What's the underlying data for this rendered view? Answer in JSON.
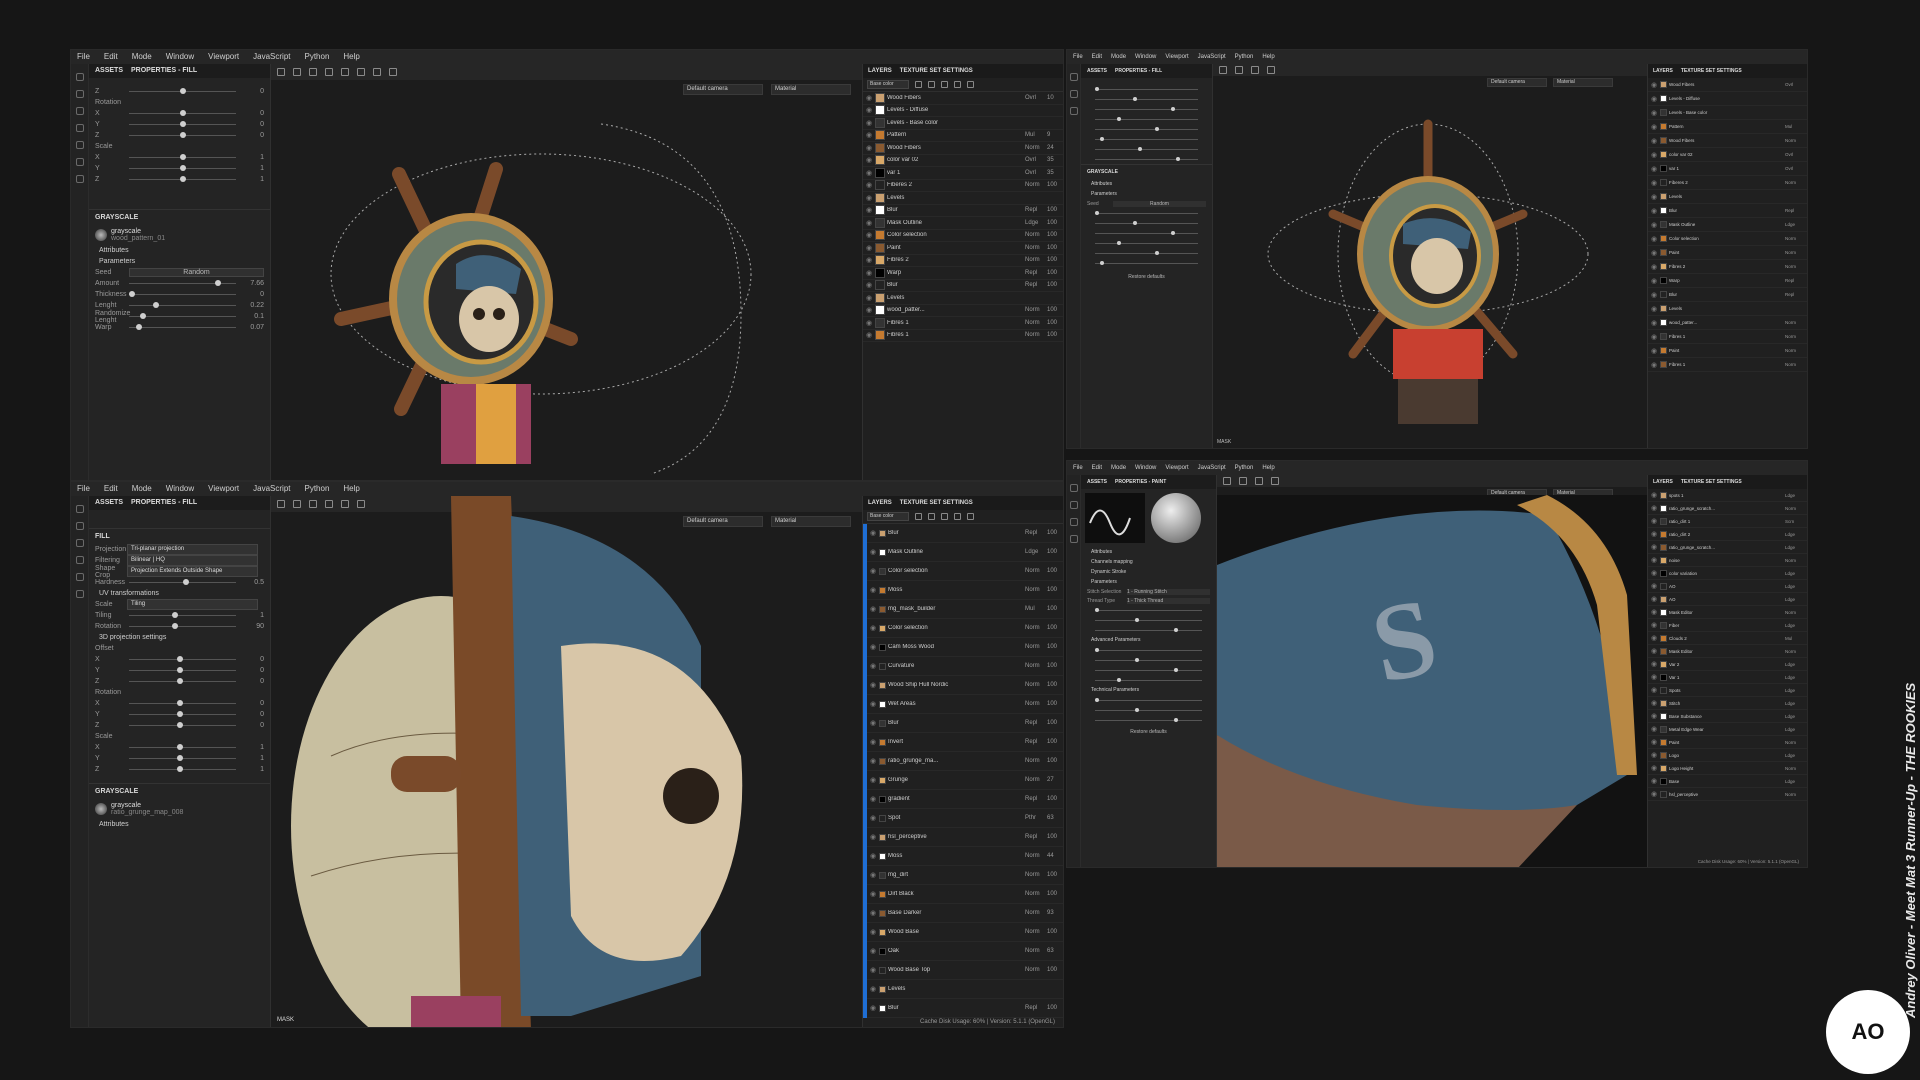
{
  "menu": [
    "File",
    "Edit",
    "Mode",
    "Window",
    "Viewport",
    "JavaScript",
    "Python",
    "Help"
  ],
  "tl": {
    "props_tabs": [
      "ASSETS",
      "PROPERTIES - FILL"
    ],
    "rows_top": [
      {
        "l": "Z",
        "v": "0"
      },
      {
        "l": "Rotation",
        "v": ""
      },
      {
        "l": "X",
        "v": "0"
      },
      {
        "l": "Y",
        "v": "0"
      },
      {
        "l": "Z",
        "v": "0"
      },
      {
        "l": "Scale",
        "v": ""
      },
      {
        "l": "X",
        "v": "1"
      },
      {
        "l": "Y",
        "v": "1"
      },
      {
        "l": "Z",
        "v": "1"
      }
    ],
    "grayscale_label": "GRAYSCALE",
    "gs_name": "grayscale",
    "gs_file": "wood_pattern_01",
    "attributes": "Attributes",
    "parameters": "Parameters",
    "seed_label": "Seed",
    "seed_value": "Random",
    "params": [
      {
        "l": "Amount",
        "v": "7.66"
      },
      {
        "l": "Thickness",
        "v": "0"
      },
      {
        "l": "Lenght",
        "v": "0.22"
      },
      {
        "l": "Randomize Lenght",
        "v": "0.1"
      },
      {
        "l": "Warp",
        "v": "0.07"
      }
    ],
    "camera": "Default camera",
    "material": "Material",
    "layers_tabs": [
      "LAYERS",
      "TEXTURE SET SETTINGS"
    ],
    "base_color": "Base color",
    "layers": [
      {
        "n": "Wood Fibers",
        "b": "Ovrl",
        "o": "10"
      },
      {
        "n": "Levels - Diffuse",
        "b": "",
        "o": ""
      },
      {
        "n": "Levels - Base color",
        "b": "",
        "o": ""
      },
      {
        "n": "Pattern",
        "b": "Mul",
        "o": "9"
      },
      {
        "n": "Wood Fibers",
        "b": "Norm",
        "o": "24"
      },
      {
        "n": "color var 02",
        "b": "Ovrl",
        "o": "35"
      },
      {
        "n": "var 1",
        "b": "Ovrl",
        "o": "35"
      },
      {
        "n": "Fiberes 2",
        "b": "Norm",
        "o": "100"
      },
      {
        "n": "Levels",
        "b": "",
        "o": ""
      },
      {
        "n": "Blur",
        "b": "Repl",
        "o": "100"
      },
      {
        "n": "Mask Outline",
        "b": "Ldge",
        "o": "100"
      },
      {
        "n": "Color selection",
        "b": "Norm",
        "o": "100"
      },
      {
        "n": "Paint",
        "b": "Norm",
        "o": "100"
      },
      {
        "n": "Fibres 2",
        "b": "Norm",
        "o": "100"
      },
      {
        "n": "Warp",
        "b": "Repl",
        "o": "100"
      },
      {
        "n": "Blur",
        "b": "Repl",
        "o": "100"
      },
      {
        "n": "Levels",
        "b": "",
        "o": ""
      },
      {
        "n": "wood_patter...",
        "b": "Norm",
        "o": "100"
      },
      {
        "n": "Fibres 1",
        "b": "Norm",
        "o": "100"
      },
      {
        "n": "Fibres 1",
        "b": "Norm",
        "o": "100"
      }
    ]
  },
  "bl": {
    "fill": "FILL",
    "projection_label": "Projection",
    "projection_value": "Tri-planar projection",
    "filtering_label": "Filtering",
    "filtering_value": "Bilinear | HQ",
    "shapecrop_label": "Shape Crop",
    "shapecrop_value": "Projection Extends Outside Shape",
    "hardness_label": "Hardness",
    "hardness_value": "0.5",
    "uv": "UV transformations",
    "scale_label": "Scale",
    "scale_value": "Tiling",
    "tiling_label": "Tiling",
    "tiling_value": "1",
    "rotation_label": "Rotation",
    "rotation_value": "90",
    "proj3d": "3D projection settings",
    "rows": [
      {
        "l": "Offset",
        "v": ""
      },
      {
        "l": "X",
        "v": "0"
      },
      {
        "l": "Y",
        "v": "0"
      },
      {
        "l": "Z",
        "v": "0"
      },
      {
        "l": "Rotation",
        "v": ""
      },
      {
        "l": "X",
        "v": "0"
      },
      {
        "l": "Y",
        "v": "0"
      },
      {
        "l": "Z",
        "v": "0"
      },
      {
        "l": "Scale",
        "v": ""
      },
      {
        "l": "X",
        "v": "1"
      },
      {
        "l": "Y",
        "v": "1"
      },
      {
        "l": "Z",
        "v": "1"
      }
    ],
    "gs_file": "ratio_grunge_map_008",
    "mask": "MASK",
    "layers": [
      {
        "n": "Blur",
        "b": "Repl",
        "o": "100"
      },
      {
        "n": "Mask Outline",
        "b": "Ldge",
        "o": "100"
      },
      {
        "n": "Color selection",
        "b": "Norm",
        "o": "100"
      },
      {
        "n": "Moss",
        "b": "Norm",
        "o": "100"
      },
      {
        "n": "mg_mask_builder",
        "b": "Mul",
        "o": "100"
      },
      {
        "n": "Color selection",
        "b": "Norm",
        "o": "100"
      },
      {
        "n": "Cam Moss Wood",
        "b": "Norm",
        "o": "100"
      },
      {
        "n": "Curvature",
        "b": "Norm",
        "o": "100"
      },
      {
        "n": "Wood Ship Hull Nordic",
        "b": "Norm",
        "o": "100"
      },
      {
        "n": "Wet Areas",
        "b": "Norm",
        "o": "100"
      },
      {
        "n": "Blur",
        "b": "Repl",
        "o": "100"
      },
      {
        "n": "Invert",
        "b": "Repl",
        "o": "100"
      },
      {
        "n": "ratio_grunge_ma...",
        "b": "Norm",
        "o": "100"
      },
      {
        "n": "Grunge",
        "b": "Norm",
        "o": "27"
      },
      {
        "n": "gradient",
        "b": "Repl",
        "o": "100"
      },
      {
        "n": "Spot",
        "b": "Pthr",
        "o": "63"
      },
      {
        "n": "hsl_perceptive",
        "b": "Repl",
        "o": "100"
      },
      {
        "n": "Moss",
        "b": "Norm",
        "o": "44"
      },
      {
        "n": "mg_dirt",
        "b": "Norm",
        "o": "100"
      },
      {
        "n": "Dirt Black",
        "b": "Norm",
        "o": "100"
      },
      {
        "n": "Base Darker",
        "b": "Norm",
        "o": "93"
      },
      {
        "n": "Wood Base",
        "b": "Norm",
        "o": "100"
      },
      {
        "n": "Oak",
        "b": "Norm",
        "o": "63"
      },
      {
        "n": "Wood Base Top",
        "b": "Norm",
        "o": "100"
      },
      {
        "n": "Levels",
        "b": "",
        "o": ""
      },
      {
        "n": "Blur",
        "b": "Repl",
        "o": "100"
      }
    ],
    "status": "Cache Disk Usage: 60% | Version: 5.1.1 (OpenGL)"
  },
  "tr": {
    "grayscale": "GRAYSCALE",
    "attributes": "Attributes",
    "parameters": "Parameters",
    "seed": "Seed",
    "seed_value": "Random",
    "restore": "Restore defaults",
    "mask": "MASK",
    "layers": [
      {
        "n": "Wood Fibers",
        "b": "Ovrl"
      },
      {
        "n": "Levels - Diffuse",
        "b": ""
      },
      {
        "n": "Levels - Base color",
        "b": ""
      },
      {
        "n": "Pattern",
        "b": "Mul"
      },
      {
        "n": "Wood Fibers",
        "b": "Norm"
      },
      {
        "n": "color var 02",
        "b": "Ovrl"
      },
      {
        "n": "var 1",
        "b": "Ovrl"
      },
      {
        "n": "Fiberes 2",
        "b": "Norm"
      },
      {
        "n": "Levels",
        "b": ""
      },
      {
        "n": "Blur",
        "b": "Repl"
      },
      {
        "n": "Mask Outline",
        "b": "Ldge"
      },
      {
        "n": "Color selection",
        "b": "Norm"
      },
      {
        "n": "Paint",
        "b": "Norm"
      },
      {
        "n": "Fibres 2",
        "b": "Norm"
      },
      {
        "n": "Warp",
        "b": "Repl"
      },
      {
        "n": "Blur",
        "b": "Repl"
      },
      {
        "n": "Levels",
        "b": ""
      },
      {
        "n": "wood_patter...",
        "b": "Norm"
      },
      {
        "n": "Fibres 1",
        "b": "Norm"
      },
      {
        "n": "Paint",
        "b": "Norm"
      },
      {
        "n": "Fibres 1",
        "b": "Norm"
      }
    ]
  },
  "br": {
    "props_tabs": [
      "ASSETS",
      "PROPERTIES - PAINT"
    ],
    "attributes": "Attributes",
    "channels": "Channels mapping",
    "dynamic": "Dynamic Stroke",
    "parameters": "Parameters",
    "stitch_selection": "Stitch Selection",
    "stitch_value": "1 - Running Stitch",
    "thread_type": "Thread Type",
    "thread_value": "1 - Thick Thread",
    "advanced": "Advanced Parameters",
    "technical": "Technical Parameters",
    "restore": "Restore defaults",
    "layers": [
      {
        "n": "spots 1",
        "b": "Ldge"
      },
      {
        "n": "ratio_grunge_scratch...",
        "b": "Norm"
      },
      {
        "n": "ratio_dirt 1",
        "b": "Scrn"
      },
      {
        "n": "ratio_dirt 2",
        "b": "Ldge"
      },
      {
        "n": "ratio_grunge_scratch...",
        "b": "Ldge"
      },
      {
        "n": "noise",
        "b": "Norm"
      },
      {
        "n": "color variation",
        "b": "Ldge"
      },
      {
        "n": "AO",
        "b": "Ldge"
      },
      {
        "n": "AO",
        "b": "Ldge"
      },
      {
        "n": "Mask Editor",
        "b": "Norm"
      },
      {
        "n": "Fiber",
        "b": "Ldge"
      },
      {
        "n": "Clouds 2",
        "b": "Mul"
      },
      {
        "n": "Mask Editor",
        "b": "Norm"
      },
      {
        "n": "Var 2",
        "b": "Ldge"
      },
      {
        "n": "Var 1",
        "b": "Ldge"
      },
      {
        "n": "Spots",
        "b": "Ldge"
      },
      {
        "n": "Stitch",
        "b": "Ldge"
      },
      {
        "n": "Base Substance",
        "b": "Ldge"
      },
      {
        "n": "Metal Edge Wear",
        "b": "Ldge"
      },
      {
        "n": "Paint",
        "b": "Norm"
      },
      {
        "n": "Logo",
        "b": "Ldge"
      },
      {
        "n": "Logo Height",
        "b": "Norm"
      },
      {
        "n": "Base",
        "b": "Ldge"
      },
      {
        "n": "hsl_perceptive",
        "b": "Norm"
      }
    ],
    "status": "Cache Disk Usage: 60% | Version: 5.1.1 (OpenGL)"
  },
  "credit": "Andrey Oliver - Meet Mat 3 Runner-Up - THE ROOKIES",
  "logo": "AO",
  "colors": {
    "bg": "#161616",
    "panel": "#242424",
    "accent_blue": "#1f6ed4",
    "wood": "#8a4e2a",
    "skull": "#d8c6a8",
    "cap": "#3f6078"
  }
}
